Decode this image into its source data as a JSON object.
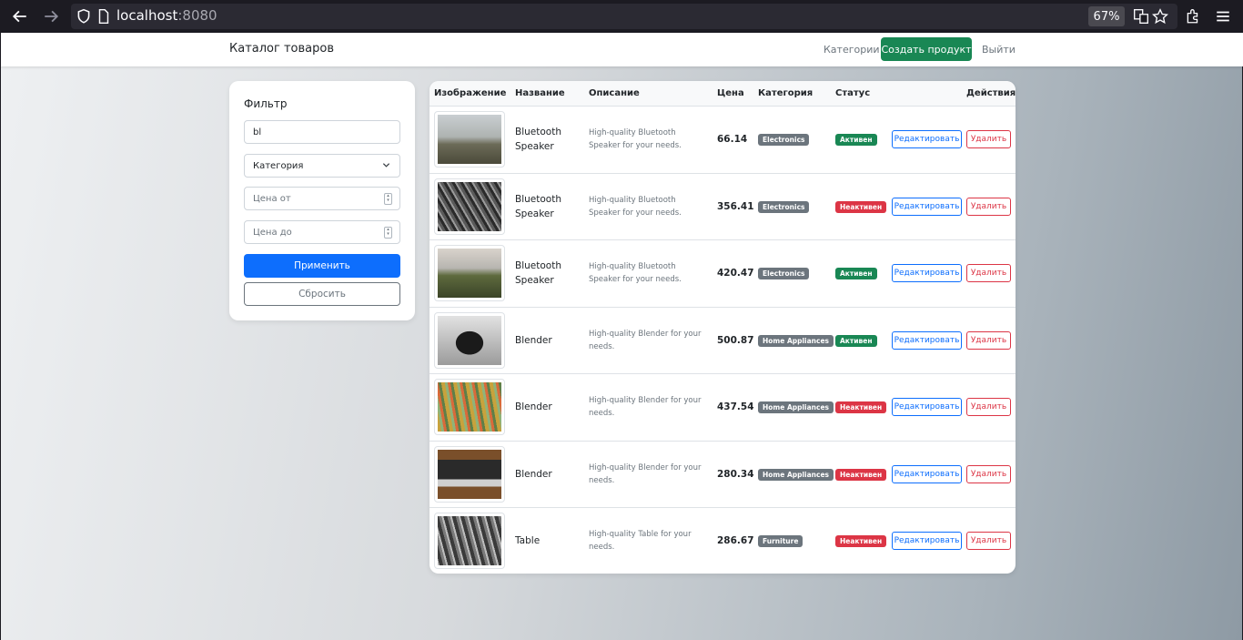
{
  "browser": {
    "url_host": "localhost",
    "url_port": ":8080",
    "zoom": "67%"
  },
  "navbar": {
    "brand": "Каталог товаров",
    "categories_link": "Категории",
    "create_button": "Создать продукт",
    "logout_link": "Выйти"
  },
  "filter": {
    "title": "Фильтр",
    "search_value": "bl",
    "category_placeholder": "Категория",
    "price_from_placeholder": "Цена от",
    "price_to_placeholder": "Цена до",
    "apply_label": "Применить",
    "reset_label": "Сбросить"
  },
  "table": {
    "headers": [
      "Изображение",
      "Название",
      "Описание",
      "Цена",
      "Категория",
      "Статус",
      "Действия"
    ],
    "edit_label": "Редактировать",
    "delete_label": "Удалить",
    "rows": [
      {
        "name": "Bluetooth Speaker",
        "description": "High-quality Bluetooth Speaker for your needs.",
        "price": "66.14",
        "category": "Electronics",
        "status": "Активен",
        "status_kind": "active",
        "image": "misty-field-photo"
      },
      {
        "name": "Bluetooth Speaker",
        "description": "High-quality Bluetooth Speaker for your needs.",
        "price": "356.41",
        "category": "Electronics",
        "status": "Неактивен",
        "status_kind": "inactive",
        "image": "grayscale-grass-photo"
      },
      {
        "name": "Bluetooth Speaker",
        "description": "High-quality Bluetooth Speaker for your needs.",
        "price": "420.47",
        "category": "Electronics",
        "status": "Активен",
        "status_kind": "active",
        "image": "meadow-trees-photo"
      },
      {
        "name": "Blender",
        "description": "High-quality Blender for your needs.",
        "price": "500.87",
        "category": "Home Appliances",
        "status": "Активен",
        "status_kind": "active",
        "image": "person-camera-photo"
      },
      {
        "name": "Blender",
        "description": "High-quality Blender for your needs.",
        "price": "437.54",
        "category": "Home Appliances",
        "status": "Неактивен",
        "status_kind": "inactive",
        "image": "colorful-plants-photo"
      },
      {
        "name": "Blender",
        "description": "High-quality Blender for your needs.",
        "price": "280.34",
        "category": "Home Appliances",
        "status": "Неактивен",
        "status_kind": "inactive",
        "image": "laptop-desk-photo"
      },
      {
        "name": "Table",
        "description": "High-quality Table for your needs.",
        "price": "286.67",
        "category": "Furniture",
        "status": "Неактивен",
        "status_kind": "inactive",
        "image": "aerial-road-photo"
      }
    ]
  }
}
